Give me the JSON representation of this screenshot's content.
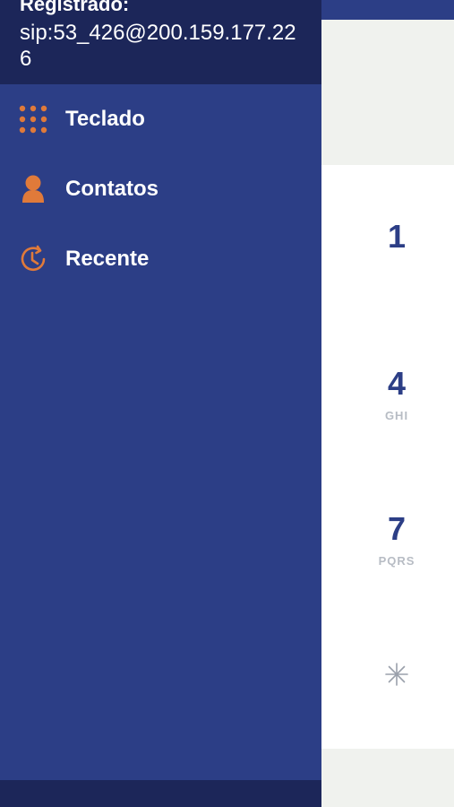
{
  "drawer": {
    "status_label": "Registrado:",
    "sip_address": "sip:53_426@200.159.177.226",
    "menu": [
      {
        "label": "Teclado",
        "icon": "keypad-icon"
      },
      {
        "label": "Contatos",
        "icon": "contact-icon"
      },
      {
        "label": "Recente",
        "icon": "history-icon"
      }
    ]
  },
  "keypad": {
    "keys": [
      {
        "digit": "1",
        "letters": ""
      },
      {
        "digit": "4",
        "letters": "GHI"
      },
      {
        "digit": "7",
        "letters": "PQRS"
      },
      {
        "digit": "",
        "letters": "",
        "icon": "asterisk-icon"
      }
    ]
  },
  "colors": {
    "drawer_bg": "#2c3e86",
    "drawer_header_bg": "#1c2659",
    "accent_orange": "#e07a3a",
    "key_text": "#2c3e86",
    "key_letters": "#b7bcc4"
  }
}
